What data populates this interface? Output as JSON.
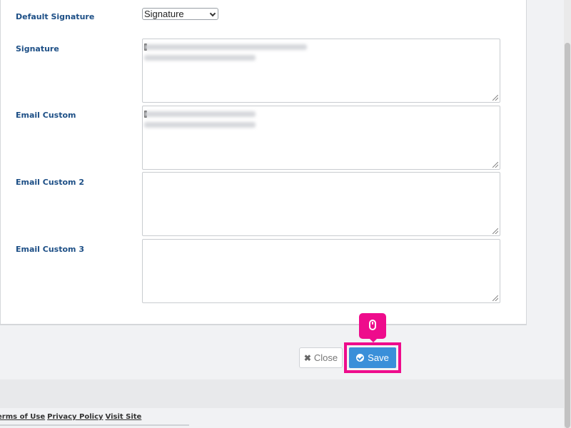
{
  "form": {
    "default_signature_label": "Default Signature",
    "default_signature_value": "Signature",
    "signature_label": "Signature",
    "email_custom_label": "Email Custom",
    "email_custom_2_label": "Email Custom 2",
    "email_custom_3_label": "Email Custom 3"
  },
  "actions": {
    "close_label": "Close",
    "save_label": "Save"
  },
  "footer": {
    "terms": "erms of Use",
    "privacy": "Privacy Policy",
    "visit": "Visit Site"
  },
  "colors": {
    "label": "#1d4f86",
    "save_button": "#3a8fd9",
    "highlight": "#ee0c8c"
  },
  "icons": {
    "close": "close-icon",
    "save": "check-circle-icon",
    "pointer": "mouse-icon"
  }
}
